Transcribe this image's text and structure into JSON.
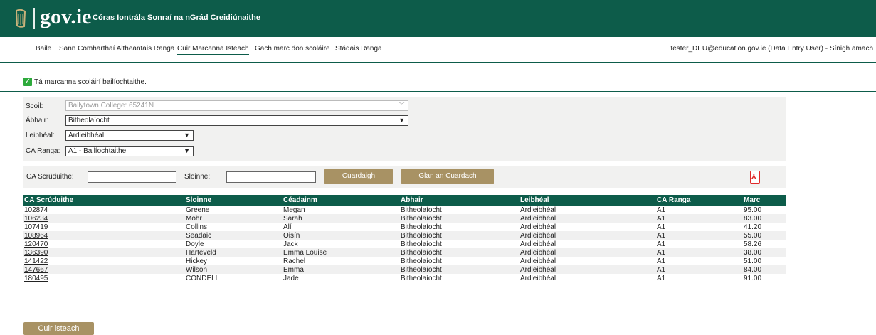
{
  "header": {
    "logo": "gov.ie",
    "app_title": "Córas Iontrála Sonraí na nGrád Creidiúnaithe",
    "brand_color": "#0d5c4a"
  },
  "nav": {
    "items": [
      {
        "label": "Baile"
      },
      {
        "label": "Sann Comharthaí Aitheantais Ranga"
      },
      {
        "label": "Cuir Marcanna Isteach",
        "active": true
      },
      {
        "label": "Gach marc don scoláire"
      },
      {
        "label": "Stádais Ranga"
      }
    ],
    "user": "tester_DEU@education.gov.ie (Data Entry User) - Sínigh amach"
  },
  "message": {
    "text": "Tá marcanna scoláirí bailíochtaithe.",
    "icon": "checkmark-icon"
  },
  "filters": {
    "school": {
      "label": "Scoil:",
      "value": "Ballytown College: 65241N"
    },
    "subject": {
      "label": "Ábhair:",
      "value": "Bitheolaíocht"
    },
    "level": {
      "label": "Leibhéal:",
      "value": "Ardleibhéal"
    },
    "class": {
      "label": "CA Ranga:",
      "value": "A1 - Bailíochtaithe"
    }
  },
  "search": {
    "exam_label": "CA Scrúduithe:",
    "surname_label": "Sloinne:",
    "search_button": "Cuardaigh",
    "clear_button": "Glan an Cuardach"
  },
  "table": {
    "headers": [
      "CA Scrúduithe",
      "Sloinne",
      "Céadainm",
      "Ábhair",
      "Leibhéal",
      "CA Ranga",
      "Marc"
    ],
    "rows": [
      [
        "102874",
        "Greene",
        "Megan",
        "Bitheolaíocht",
        "Ardleibhéal",
        "A1",
        "95.00"
      ],
      [
        "106234",
        "Mohr",
        "Sarah",
        "Bitheolaíocht",
        "Ardleibhéal",
        "A1",
        "83.00"
      ],
      [
        "107419",
        "Collins",
        "Alí",
        "Bitheolaíocht",
        "Ardleibhéal",
        "A1",
        "41.20"
      ],
      [
        "108964",
        "Seadaic",
        "Oisín",
        "Bitheolaíocht",
        "Ardleibhéal",
        "A1",
        "55.00"
      ],
      [
        "120470",
        "Doyle",
        "Jack",
        "Bitheolaíocht",
        "Ardleibhéal",
        "A1",
        "58.26"
      ],
      [
        "136390",
        "Harteveld",
        "Emma Louise",
        "Bitheolaíocht",
        "Ardleibhéal",
        "A1",
        "38.00"
      ],
      [
        "141422",
        "Hickey",
        "Rachel",
        "Bitheolaíocht",
        "Ardleibhéal",
        "A1",
        "51.00"
      ],
      [
        "147667",
        "Wilson",
        "Emma",
        "Bitheolaíocht",
        "Ardleibhéal",
        "A1",
        "84.00"
      ],
      [
        "180495",
        "CONDELL",
        "Jade",
        "Bitheolaíocht",
        "Ardleibhéal",
        "A1",
        "91.00"
      ]
    ]
  },
  "submit_button": "Cuir isteach"
}
